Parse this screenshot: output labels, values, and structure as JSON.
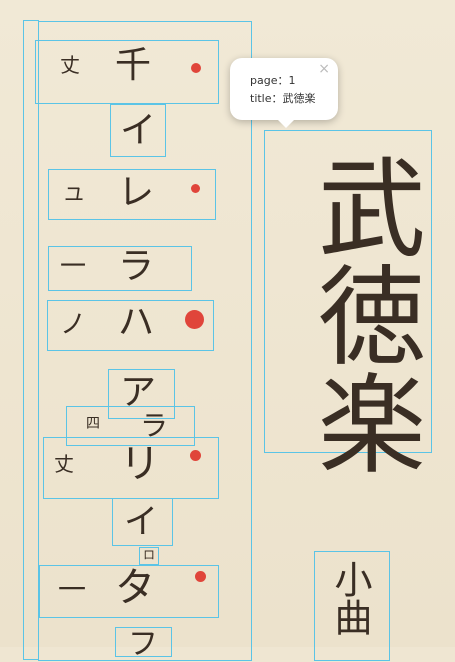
{
  "tooltip": {
    "page_label": "page：",
    "page_value": "1",
    "title_label": "title：",
    "title_value": "武徳楽",
    "close": "×"
  },
  "score": {
    "title": "武徳楽",
    "subtitle": "小曲",
    "rows": [
      {
        "left": "丈",
        "main": "千"
      },
      {
        "left": "",
        "main": "イ"
      },
      {
        "left": "ユ",
        "main": "レ"
      },
      {
        "left": "一",
        "main": "ラ"
      },
      {
        "left": "ノ",
        "main": "ハ"
      },
      {
        "left": "",
        "main": "ア"
      },
      {
        "left": "四",
        "main": "ラ"
      },
      {
        "left": "丈",
        "main": "リ"
      },
      {
        "left": "",
        "main": "イ"
      },
      {
        "left": "",
        "main": "ロ"
      },
      {
        "left": "一",
        "main": "タ"
      },
      {
        "left": "",
        "main": "フ"
      }
    ]
  }
}
